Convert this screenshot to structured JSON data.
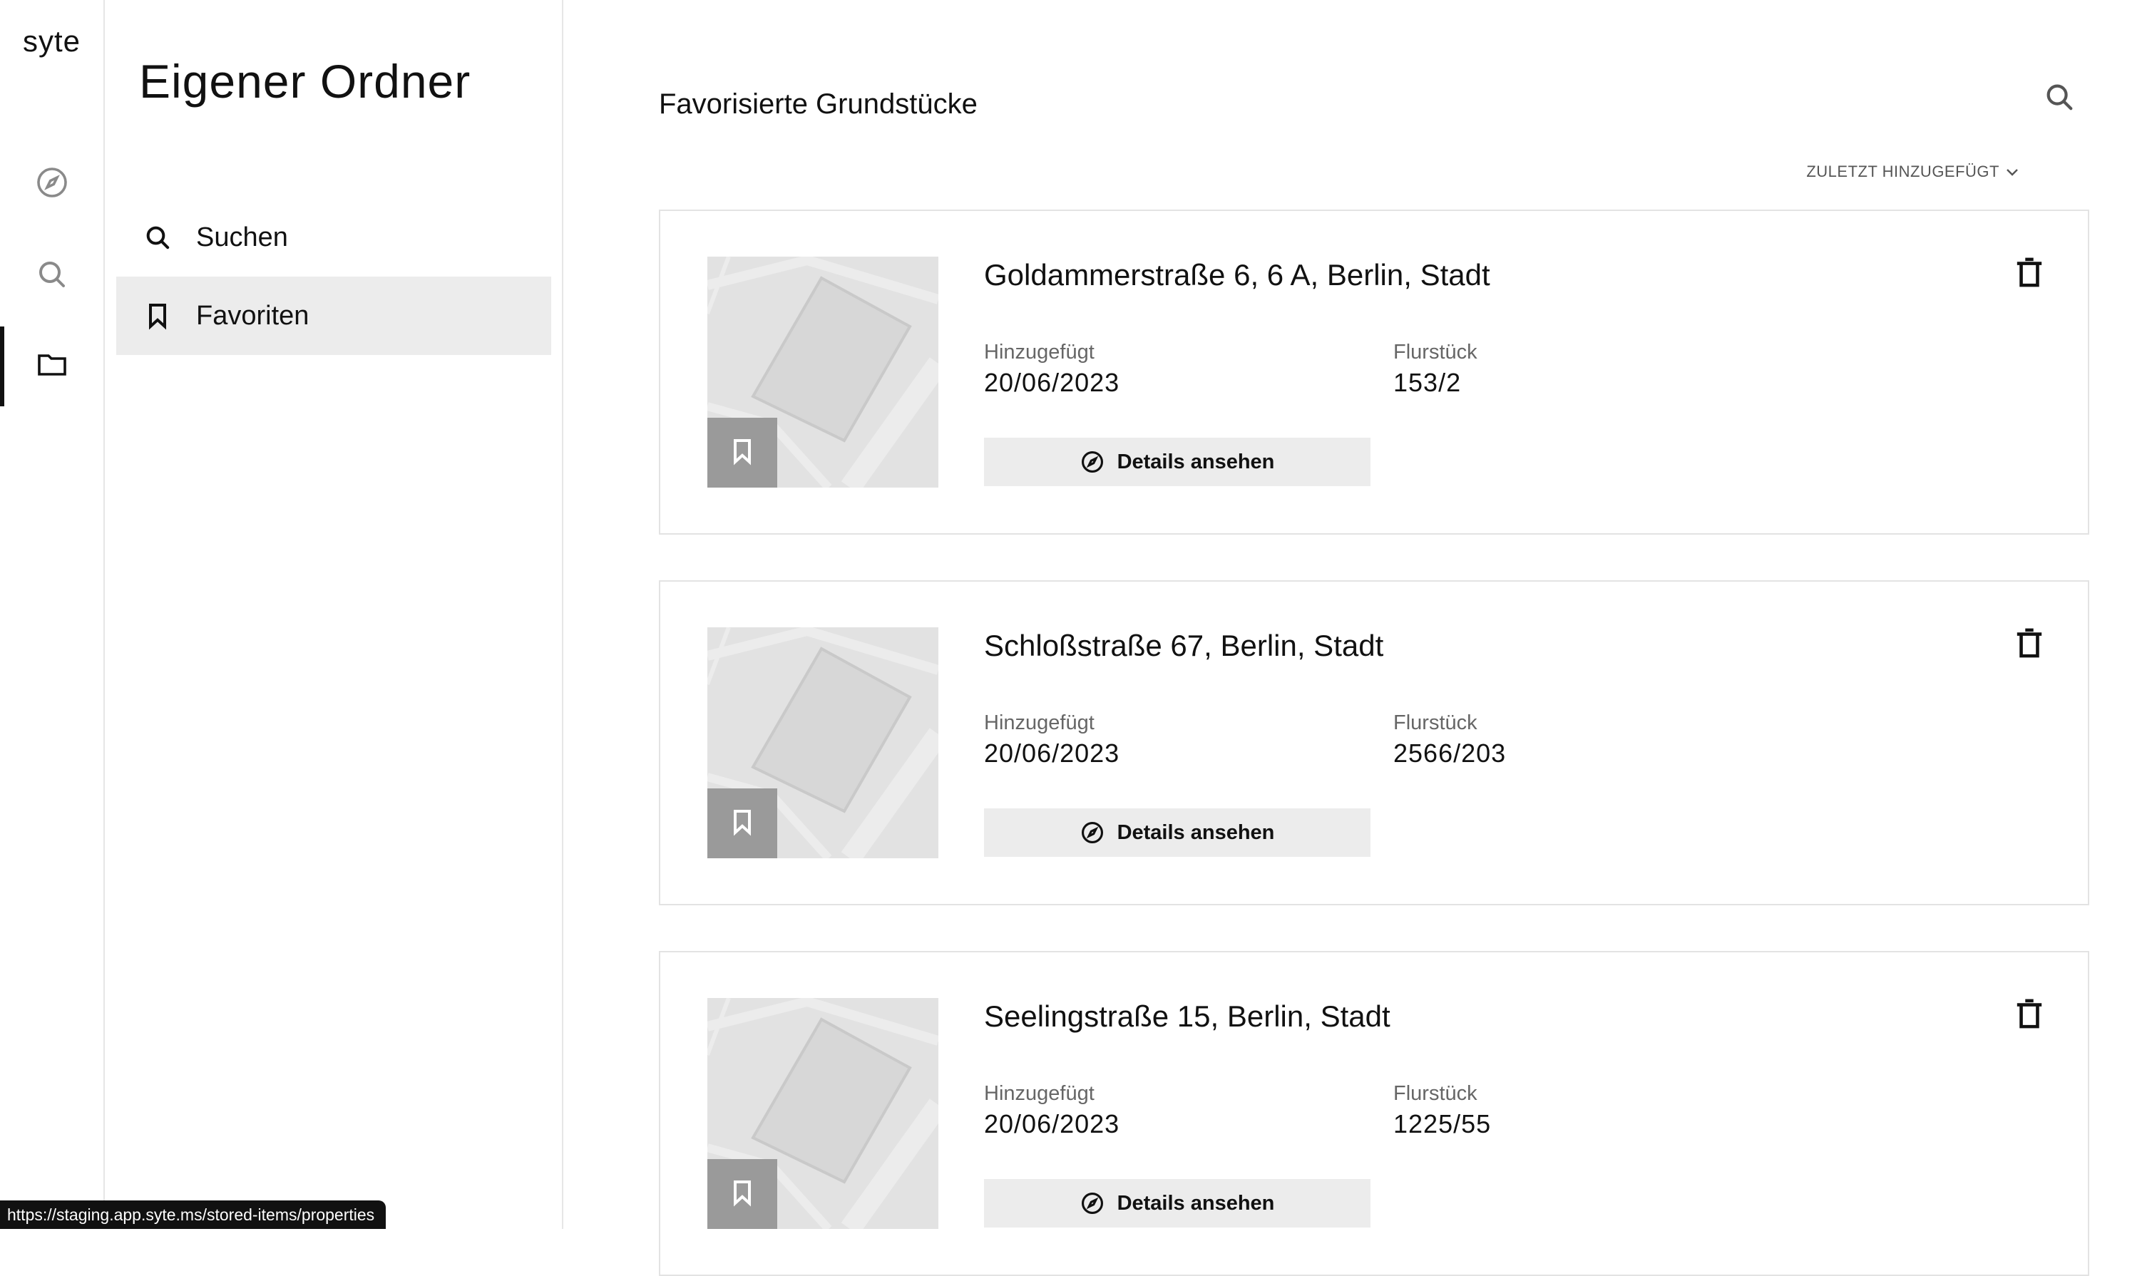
{
  "app": {
    "logo": "syte"
  },
  "rail": {
    "items": [
      {
        "icon": "compass-icon",
        "active": false
      },
      {
        "icon": "search-icon",
        "active": false
      },
      {
        "icon": "folder-icon",
        "active": true
      }
    ]
  },
  "folder": {
    "title": "Eigener Ordner",
    "nav": [
      {
        "label": "Suchen",
        "icon": "search-icon",
        "active": false
      },
      {
        "label": "Favoriten",
        "icon": "bookmark-icon",
        "active": true
      }
    ]
  },
  "main": {
    "title": "Favorisierte Grundstücke",
    "sort_label": "ZULETZT HINZUGEFÜGT",
    "details_label": "Details ansehen",
    "added_label": "Hinzugefügt",
    "parcel_label": "Flurstück",
    "cards": [
      {
        "address": "Goldammerstraße 6, 6 A, Berlin, Stadt",
        "added": "20/06/2023",
        "parcel": "153/2"
      },
      {
        "address": "Schloßstraße 67, Berlin, Stadt",
        "added": "20/06/2023",
        "parcel": "2566/203"
      },
      {
        "address": "Seelingstraße 15, Berlin, Stadt",
        "added": "20/06/2023",
        "parcel": "1225/55"
      }
    ]
  },
  "status_bar": {
    "url": "https://staging.app.syte.ms/stored-items/properties"
  }
}
